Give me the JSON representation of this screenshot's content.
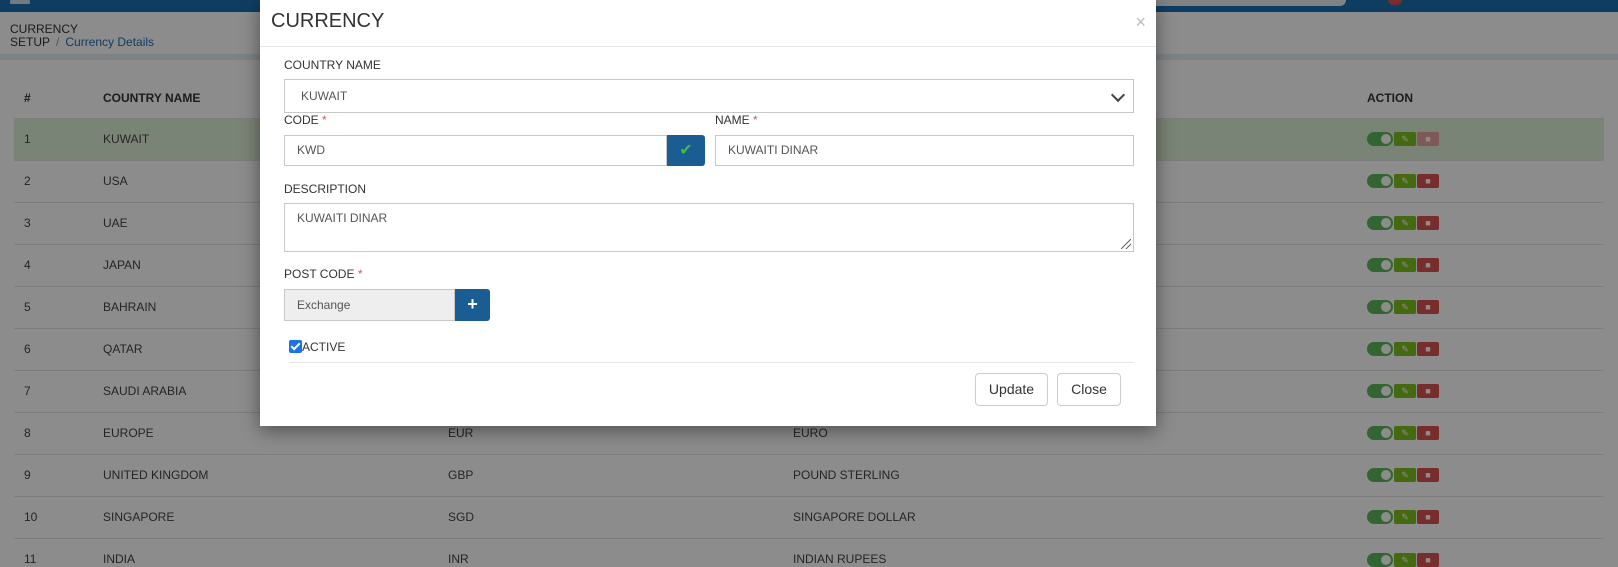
{
  "page": {
    "breadcrumb_root": "CURRENCY\nSETUP",
    "breadcrumb_root_line1": "CURRENCY",
    "breadcrumb_root_line2": "SETUP",
    "breadcrumb_sep": "/",
    "breadcrumb_current": "Currency Details"
  },
  "table": {
    "headers": [
      "#",
      "COUNTRY NAME",
      "",
      "",
      "ACTION"
    ],
    "rows": [
      {
        "num": "1",
        "country": "KUWAIT",
        "code": "",
        "name": ""
      },
      {
        "num": "2",
        "country": "USA",
        "code": "",
        "name": ""
      },
      {
        "num": "3",
        "country": "UAE",
        "code": "",
        "name": ""
      },
      {
        "num": "4",
        "country": "JAPAN",
        "code": "",
        "name": ""
      },
      {
        "num": "5",
        "country": "BAHRAIN",
        "code": "",
        "name": ""
      },
      {
        "num": "6",
        "country": "QATAR",
        "code": "",
        "name": ""
      },
      {
        "num": "7",
        "country": "SAUDI ARABIA",
        "code": "",
        "name": ""
      },
      {
        "num": "8",
        "country": "EUROPE",
        "code": "EUR",
        "name": "EURO"
      },
      {
        "num": "9",
        "country": "UNITED KINGDOM",
        "code": "GBP",
        "name": "POUND STERLING"
      },
      {
        "num": "10",
        "country": "SINGAPORE",
        "code": "SGD",
        "name": "SINGAPORE DOLLAR"
      },
      {
        "num": "11",
        "country": "INDIA",
        "code": "INR",
        "name": "INDIAN RUPEES"
      }
    ],
    "active_color": "#5cb85c",
    "edit_color": "#7fbf1f",
    "delete_color": "#d9534f"
  },
  "modal": {
    "title": "CURRENCY",
    "close_glyph": "×",
    "country_label": "COUNTRY NAME",
    "country_value": "KUWAIT",
    "code_label": "CODE",
    "code_value": "KWD",
    "name_label": "NAME",
    "name_value": "KUWAITI DINAR",
    "required_mark": "*",
    "description_label": "DESCRIPTION",
    "description_value": "KUWAITI DINAR",
    "post_code_label": "POST CODE",
    "post_code_value": "Exchange",
    "active_label": "ACTIVE",
    "active_checked": true,
    "update_button": "Update",
    "close_button": "Close",
    "accent_color": "#1a5d93"
  }
}
